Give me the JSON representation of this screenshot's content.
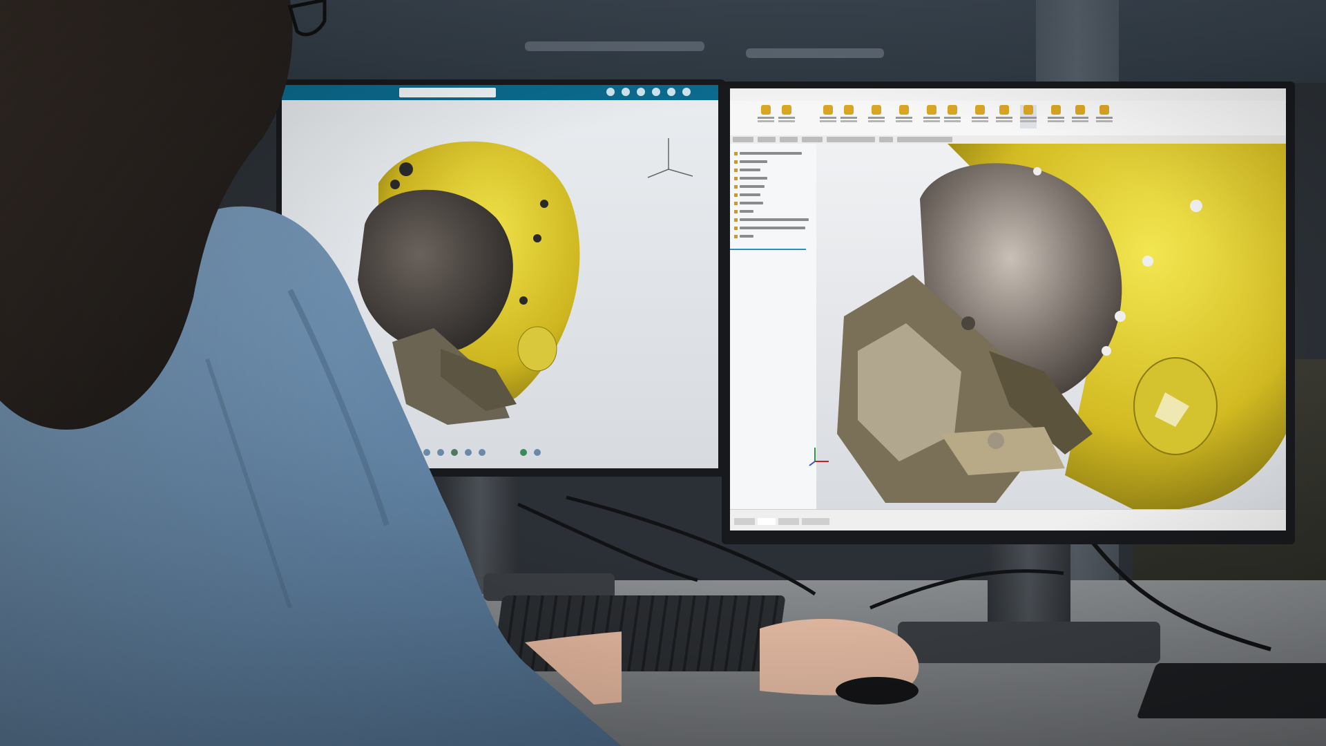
{
  "scene": {
    "description_free": true
  },
  "left_app": {
    "window_title": "",
    "accent_color": "#0b6b8f"
  },
  "right_app": {
    "brand_text": "",
    "accent_color": "#c0202a"
  },
  "colors": {
    "helmet_yellow": "#d8c22a",
    "visor_dark": "#3a3633",
    "shirt_blue": "#6e90b0",
    "hair_dark": "#22201f"
  }
}
